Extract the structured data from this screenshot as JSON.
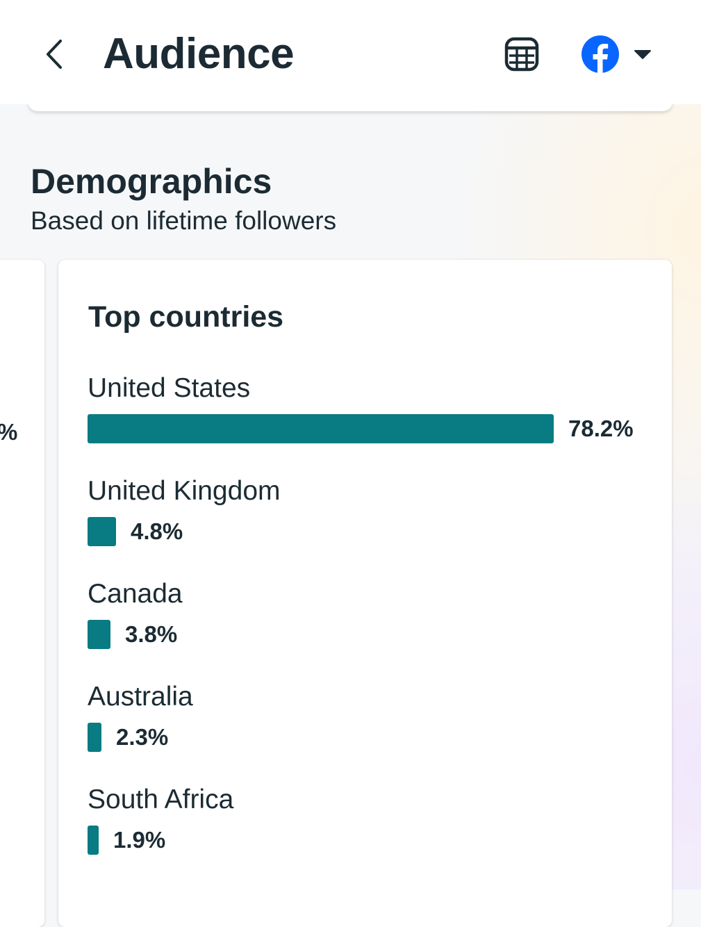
{
  "header": {
    "title": "Audience",
    "back_icon": "chevron-left-icon",
    "table_icon": "table-icon",
    "platform_icon": "facebook-icon",
    "dropdown_icon": "caret-down-icon",
    "brand_color": "#0866ff"
  },
  "demographics": {
    "title": "Demographics",
    "subtitle": "Based on lifetime followers",
    "previous_card_value": "%"
  },
  "top_countries": {
    "title": "Top countries",
    "bar_color": "#087b83",
    "items": [
      {
        "name": "United States",
        "value": "78.2%",
        "percent": 78.2
      },
      {
        "name": "United Kingdom",
        "value": "4.8%",
        "percent": 4.8
      },
      {
        "name": "Canada",
        "value": "3.8%",
        "percent": 3.8
      },
      {
        "name": "Australia",
        "value": "2.3%",
        "percent": 2.3
      },
      {
        "name": "South Africa",
        "value": "1.9%",
        "percent": 1.9
      }
    ]
  }
}
